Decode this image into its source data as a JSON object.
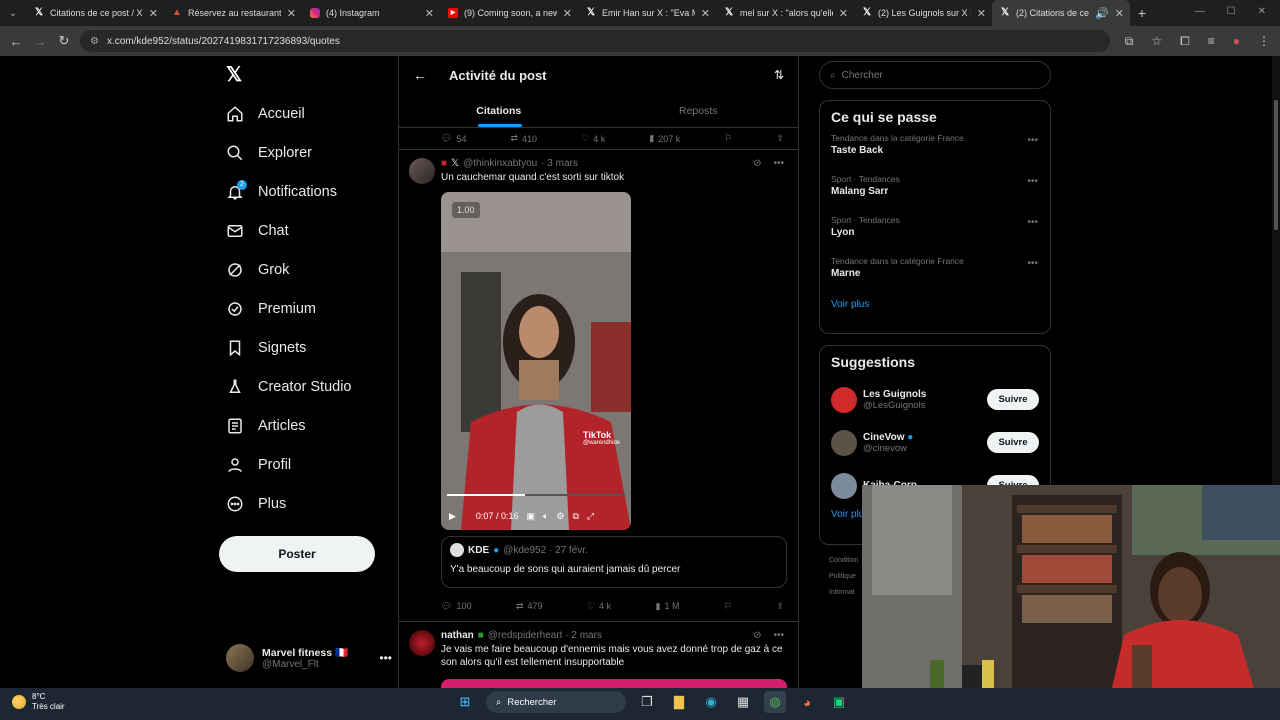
{
  "browser": {
    "tabs": [
      {
        "title": "Citations de ce post / X",
        "icon": "x-logo-icon"
      },
      {
        "title": "Réservez au restaurant Le",
        "icon": "restaurant-icon"
      },
      {
        "title": "(4) Instagram",
        "icon": "instagram-icon"
      },
      {
        "title": "(9) Coming soon, a new R",
        "icon": "youtube-icon"
      },
      {
        "title": "Emir Han sur X : \"Eva Me",
        "icon": "x-logo-icon"
      },
      {
        "title": "mel sur X : \"alors qu'elle",
        "icon": "x-logo-icon"
      },
      {
        "title": "(2) Les Guignols sur X : \"",
        "icon": "x-logo-icon"
      },
      {
        "title": "(2) Citations de ce po",
        "icon": "x-logo-icon"
      }
    ],
    "url": "x.com/kde952/status/2027419831717236893/quotes"
  },
  "sidebar": {
    "logo": "X",
    "items": [
      {
        "label": "Accueil",
        "icon": "home-icon"
      },
      {
        "label": "Explorer",
        "icon": "search-icon"
      },
      {
        "label": "Notifications",
        "icon": "bell-icon",
        "badge": "2"
      },
      {
        "label": "Chat",
        "icon": "mail-icon"
      },
      {
        "label": "Grok",
        "icon": "grok-icon"
      },
      {
        "label": "Premium",
        "icon": "verified-icon"
      },
      {
        "label": "Signets",
        "icon": "bookmark-icon"
      },
      {
        "label": "Creator Studio",
        "icon": "flask-icon"
      },
      {
        "label": "Articles",
        "icon": "article-icon"
      },
      {
        "label": "Profil",
        "icon": "person-icon"
      },
      {
        "label": "Plus",
        "icon": "more-circle-icon"
      }
    ],
    "post_button": "Poster",
    "account": {
      "name": "Marvel fitness 🇫🇷",
      "handle": "@Marvel_Flt"
    }
  },
  "main": {
    "title": "Activité du post",
    "tabs": [
      "Citations",
      "Reposts"
    ],
    "top_actions": {
      "replies": "54",
      "reposts": "410",
      "likes": "4 k",
      "views": "207 k"
    },
    "tweet1": {
      "handle": "@thinkinxabtyou",
      "time": "· 3 mars",
      "text": "Un cauchemar quand c'est sorti sur tiktok",
      "video": {
        "speed": "1.00",
        "time": "0:07 / 0:16",
        "watermark": "TikTok",
        "watermark_user": "@warendhide",
        "progress": 0.44
      },
      "quote": {
        "name": "KDE",
        "handle": "@kde952 · 27 févr.",
        "text": "Y'a beaucoup de sons qui auraient jamais dû percer"
      },
      "actions": {
        "replies": "100",
        "reposts": "479",
        "likes": "4 k",
        "views": "1 M"
      }
    },
    "tweet2": {
      "name": "nathan",
      "handle": "@redspiderheart · 2 mars",
      "text": "Je vais me faire beaucoup d'ennemis mais vous avez donné trop de gaz à ce son alors qu'il est tellement insupportable"
    }
  },
  "right": {
    "search_placeholder": "Chercher",
    "trends_title": "Ce qui se passe",
    "trends": [
      {
        "category": "Tendance dans la catégorie France",
        "name": "Taste Back"
      },
      {
        "category": "Sport · Tendances",
        "name": "Malang Sarr"
      },
      {
        "category": "Sport · Tendances",
        "name": "Lyon"
      },
      {
        "category": "Tendance dans la catégorie France",
        "name": "Marne"
      }
    ],
    "show_more": "Voir plus",
    "suggestions_title": "Suggestions",
    "suggestions": [
      {
        "name": "Les Guignols",
        "handle": "@LesGuignols",
        "button": "Suivre"
      },
      {
        "name": "CineVow",
        "handle": "@cinevow",
        "button": "Suivre"
      },
      {
        "name": "Kaiba-Corp",
        "handle": "",
        "button": "Suivre"
      }
    ],
    "show_more2": "Voir plu",
    "footer": [
      "Condition",
      "Politique",
      "Informat"
    ]
  },
  "taskbar": {
    "temp": "8°C",
    "weather": "Très clair",
    "search": "Rechercher"
  },
  "colors": {
    "accent": "#1d9bf0",
    "bg": "#000000",
    "border": "#2f3336",
    "muted": "#71767b"
  }
}
